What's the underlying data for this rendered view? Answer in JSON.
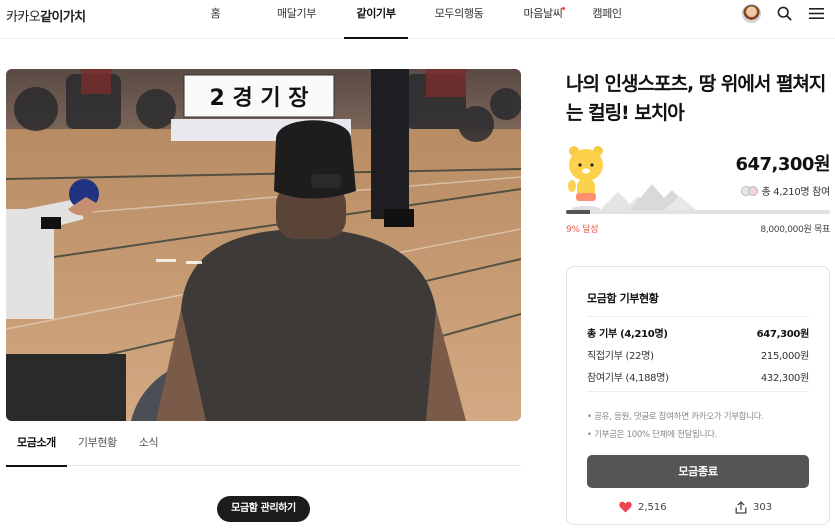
{
  "header": {
    "logo_prefix": "카카오",
    "logo_main": "같이가치",
    "nav": [
      {
        "label": "홈"
      },
      {
        "label": "매달기부"
      },
      {
        "label": "같이기부",
        "active": true
      },
      {
        "label": "모두의행동"
      },
      {
        "label": "마음날씨",
        "dot": true
      },
      {
        "label": "캠페인"
      }
    ],
    "icons": [
      "profile-avatar",
      "search-icon",
      "menu-icon"
    ]
  },
  "hero": {
    "sign_text": "2 경 기 장"
  },
  "content_tabs": [
    {
      "label": "모금소개",
      "active": true
    },
    {
      "label": "기부현황"
    },
    {
      "label": "소식"
    }
  ],
  "manage_button": "모금함 관리하기",
  "campaign": {
    "title": "나의 인생스포츠, 땅 위에서 펼쳐지는 컬링! 보치아",
    "amount": "647,300원",
    "participants": "총 4,210명 참여",
    "progress_fraction": 0.09,
    "percent_label": "9% 달성",
    "goal_label": "8,000,000원 목표"
  },
  "status_card": {
    "title": "모금함 기부현황",
    "rows": [
      {
        "label": "총 기부 (4,210명)",
        "value": "647,300원"
      },
      {
        "label": "직접기부 (22명)",
        "value": "215,000원"
      },
      {
        "label": "참여기부 (4,188명)",
        "value": "432,300원"
      }
    ],
    "notes": [
      "• 공유, 응원, 댓글로 참여하면 카카오가 기부합니다.",
      "• 기부금은 100% 단체에 전달됩니다."
    ],
    "end_button": "모금종료",
    "likes": "2,516",
    "shares": "303"
  },
  "colors": {
    "accent_red": "#e55a4e",
    "heart": "#f04452",
    "button_dark": "#1c1c1c",
    "button_gray": "#555555"
  }
}
